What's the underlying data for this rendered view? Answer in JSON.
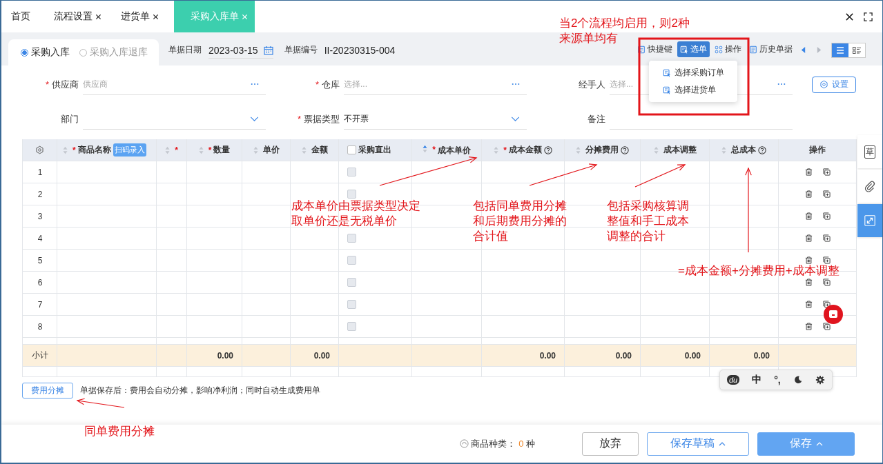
{
  "tabs": [
    {
      "label": "首页",
      "closable": false,
      "selected": false
    },
    {
      "label": "流程设置",
      "closable": true,
      "selected": false
    },
    {
      "label": "进货单",
      "closable": true,
      "selected": false
    },
    {
      "label": "采购入库单",
      "closable": true,
      "selected": true
    }
  ],
  "header": {
    "radios": [
      {
        "label": "采购入库",
        "selected": true
      },
      {
        "label": "采购入库退库",
        "selected": false
      }
    ],
    "date": {
      "label": "单据日期",
      "value": "2023-03-15"
    },
    "number": {
      "label": "单据编号",
      "value": "II-20230315-004"
    },
    "toolbar": [
      {
        "kind": "shortcut",
        "label": "快捷键",
        "selected": false
      },
      {
        "kind": "select",
        "label": "选单",
        "selected": true,
        "menu": [
          "选择采购订单",
          "选择进货单"
        ]
      },
      {
        "kind": "grid",
        "label": "操作",
        "selected": false
      },
      {
        "kind": "history",
        "label": "历史单据",
        "selected": false
      }
    ],
    "pager": [
      {
        "kind": "prev",
        "disabled": false
      },
      {
        "kind": "next",
        "disabled": true
      }
    ],
    "views": [
      {
        "kind": "list",
        "selected": true
      },
      {
        "kind": "detail",
        "selected": false
      }
    ]
  },
  "form": {
    "rows": [
      [
        {
          "label": "供应商",
          "required_mark": "*",
          "kind": "lookup",
          "placeholder": "供应商"
        },
        {
          "label": "仓库",
          "required_mark": "*",
          "kind": "lookup",
          "placeholder": "选择..."
        },
        {
          "label": "经手人",
          "kind": "lookup",
          "placeholder": "选择..."
        }
      ],
      [
        {
          "label": "部门",
          "kind": "select"
        },
        {
          "label": "票据类型",
          "required_mark": "*",
          "kind": "select",
          "value": "不开票"
        },
        {
          "label": "备注",
          "kind": "text"
        }
      ]
    ],
    "settings_button": "设置"
  },
  "table": {
    "columns": [
      {
        "kind": "settings",
        "sortable": false,
        "help": false
      },
      {
        "kind": "text",
        "label": "商品名称",
        "badge": "扫码录入",
        "required_mark": "*",
        "sortable": true,
        "sorted": false,
        "help": false
      },
      {
        "kind": "text",
        "required_mark": "*",
        "sortable": true,
        "sorted": false,
        "help": false
      },
      {
        "kind": "text",
        "label": "数量",
        "required_mark": "*",
        "sortable": true,
        "sorted": false,
        "help": false,
        "subtotal": "0.00"
      },
      {
        "kind": "text",
        "label": "单价",
        "sortable": true,
        "sorted": false,
        "help": false
      },
      {
        "kind": "text",
        "label": "金额",
        "sortable": true,
        "sorted": false,
        "help": false,
        "subtotal": "0.00"
      },
      {
        "kind": "checkbox",
        "label": "采购直出",
        "checked": false,
        "sortable": false,
        "help": false
      },
      {
        "kind": "text",
        "label": "成本单价",
        "required_mark": "*",
        "sortable": true,
        "sorted": true,
        "help": false
      },
      {
        "kind": "text",
        "label": "成本金额",
        "required_mark": "*",
        "sortable": true,
        "sorted": false,
        "help": true,
        "subtotal": "0.00"
      },
      {
        "kind": "text",
        "label": "分摊费用",
        "sortable": true,
        "sorted": false,
        "help": true,
        "subtotal": "0.00"
      },
      {
        "kind": "text",
        "label": "成本调整",
        "sortable": true,
        "sorted": false,
        "help": false,
        "subtotal": "0.00"
      },
      {
        "kind": "text",
        "label": "总成本",
        "sortable": true,
        "sorted": false,
        "help": true,
        "subtotal": "0.00"
      },
      {
        "kind": "actions",
        "label": "操作",
        "sortable": false,
        "help": false
      }
    ],
    "rows": [
      {
        "index": "1",
        "checked": false,
        "disabled": true
      },
      {
        "index": "2",
        "checked": false,
        "disabled": true
      },
      {
        "index": "3"
      },
      {
        "index": "4",
        "checked": false,
        "disabled": true
      },
      {
        "index": "5",
        "checked": false,
        "disabled": true
      },
      {
        "index": "6",
        "checked": false,
        "disabled": true
      },
      {
        "index": "7",
        "checked": false,
        "disabled": true
      },
      {
        "index": "8",
        "checked": false,
        "disabled": true
      }
    ],
    "subtotal_label": "小计"
  },
  "fee": {
    "button": "费用分摊",
    "note": "单据保存后：费用会自动分摊，影响净利润；同时自动生成费用单"
  },
  "footer": {
    "count_label": "商品种类：",
    "count": "0",
    "count_unit": "种",
    "buttons": [
      {
        "kind": "plain",
        "label": "放弃",
        "caret": false
      },
      {
        "kind": "outline",
        "label": "保存草稿",
        "caret": true
      },
      {
        "kind": "primary",
        "label": "保存",
        "caret": true
      }
    ]
  },
  "side_tools": [
    {
      "kind": "draft",
      "label": "草",
      "selected": false
    },
    {
      "kind": "attach",
      "selected": false
    },
    {
      "kind": "expand",
      "selected": true
    }
  ],
  "ime": [
    {
      "kind": "logo",
      "label": "du"
    },
    {
      "kind": "text",
      "label": "中"
    },
    {
      "kind": "text",
      "label": "°,"
    },
    {
      "kind": "moon"
    },
    {
      "kind": "gear"
    }
  ],
  "annotations": [
    {
      "lines": [
        "当2个流程均启用，则2种",
        "来源单均有"
      ]
    },
    {
      "lines": [
        "成本单价由票据类型决定",
        "取单价还是无税单价"
      ]
    },
    {
      "lines": [
        "包括同单费用分摊",
        "和后期费用分摊的",
        "合计值"
      ]
    },
    {
      "lines": [
        "包括采购核算调",
        "整值和手工成本",
        "调整的合计"
      ]
    },
    {
      "lines": [
        "=成本金额+分摊费用+成本调整"
      ]
    },
    {
      "lines": [
        "同单费用分摊"
      ]
    }
  ]
}
